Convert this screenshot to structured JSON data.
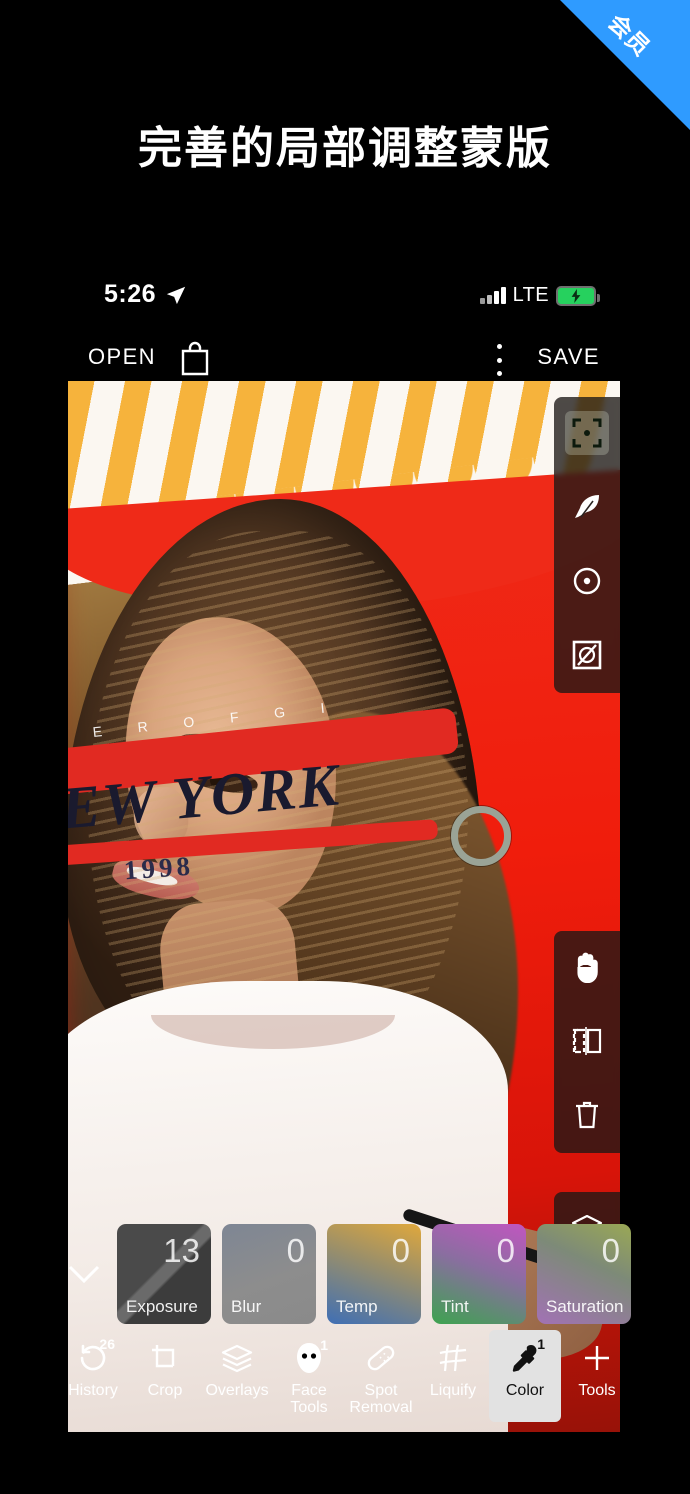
{
  "ribbon": {
    "label": "会员",
    "color": "#2f9bff"
  },
  "headline": {
    "text": "完善的局部调整蒙版"
  },
  "statusbar": {
    "time": "5:26",
    "location_icon": "location-arrow-icon",
    "network": "LTE",
    "signal_icon": "signal-bars-icon",
    "battery_icon": "battery-charging-icon",
    "battery_color": "#26d15e"
  },
  "toolbar": {
    "open_label": "OPEN",
    "store_icon": "shopping-bag-icon",
    "menu_icon": "more-vertical-icon",
    "save_label": "SAVE"
  },
  "canvas": {
    "photo_description": "Woman in white NEW YORK 1998 t-shirt against a red wall under an orange striped awning",
    "shirt_text_main": "EW YORK",
    "shirt_text_year": "1998",
    "shirt_text_small": "E R O F G I",
    "radial_control": "radial-mask-handle"
  },
  "right_panel_top": {
    "items": [
      {
        "name": "selection-mask-icon",
        "active": true
      },
      {
        "name": "feather-icon",
        "active": false
      },
      {
        "name": "radial-mask-icon",
        "active": false
      },
      {
        "name": "invert-mask-icon",
        "active": false
      }
    ]
  },
  "right_panel_bottom": {
    "items": [
      {
        "name": "hand-pan-icon",
        "active": false
      },
      {
        "name": "mirror-flip-icon",
        "active": false
      },
      {
        "name": "delete-trash-icon",
        "active": false
      }
    ],
    "layers": {
      "name": "layers-icon",
      "active": false
    }
  },
  "adjustments": {
    "collapse_icon": "chevron-down-icon",
    "chips": [
      {
        "label": "Exposure",
        "value": "13",
        "class": "c-exposure"
      },
      {
        "label": "Blur",
        "value": "0",
        "class": "c-blur"
      },
      {
        "label": "Temp",
        "value": "0",
        "class": "c-temp"
      },
      {
        "label": "Tint",
        "value": "0",
        "class": "c-tint"
      },
      {
        "label": "Saturation",
        "value": "0",
        "class": "c-sat"
      }
    ]
  },
  "bottom_nav": {
    "items": [
      {
        "label": "History",
        "icon": "history-undo-icon",
        "badge": "26",
        "selected": false
      },
      {
        "label": "Crop",
        "icon": "crop-icon",
        "badge": "",
        "selected": false
      },
      {
        "label": "Overlays",
        "icon": "layers-icon",
        "badge": "",
        "selected": false
      },
      {
        "label": "Face\nTools",
        "icon": "face-tools-icon",
        "badge": "1",
        "selected": false
      },
      {
        "label": "Spot\nRemoval",
        "icon": "bandage-icon",
        "badge": "",
        "selected": false
      },
      {
        "label": "Liquify",
        "icon": "liquify-grid-icon",
        "badge": "",
        "selected": false
      },
      {
        "label": "Color",
        "icon": "eyedropper-icon",
        "badge": "1",
        "selected": true
      },
      {
        "label": "Tools",
        "icon": "plus-icon",
        "badge": "",
        "selected": false
      }
    ]
  }
}
